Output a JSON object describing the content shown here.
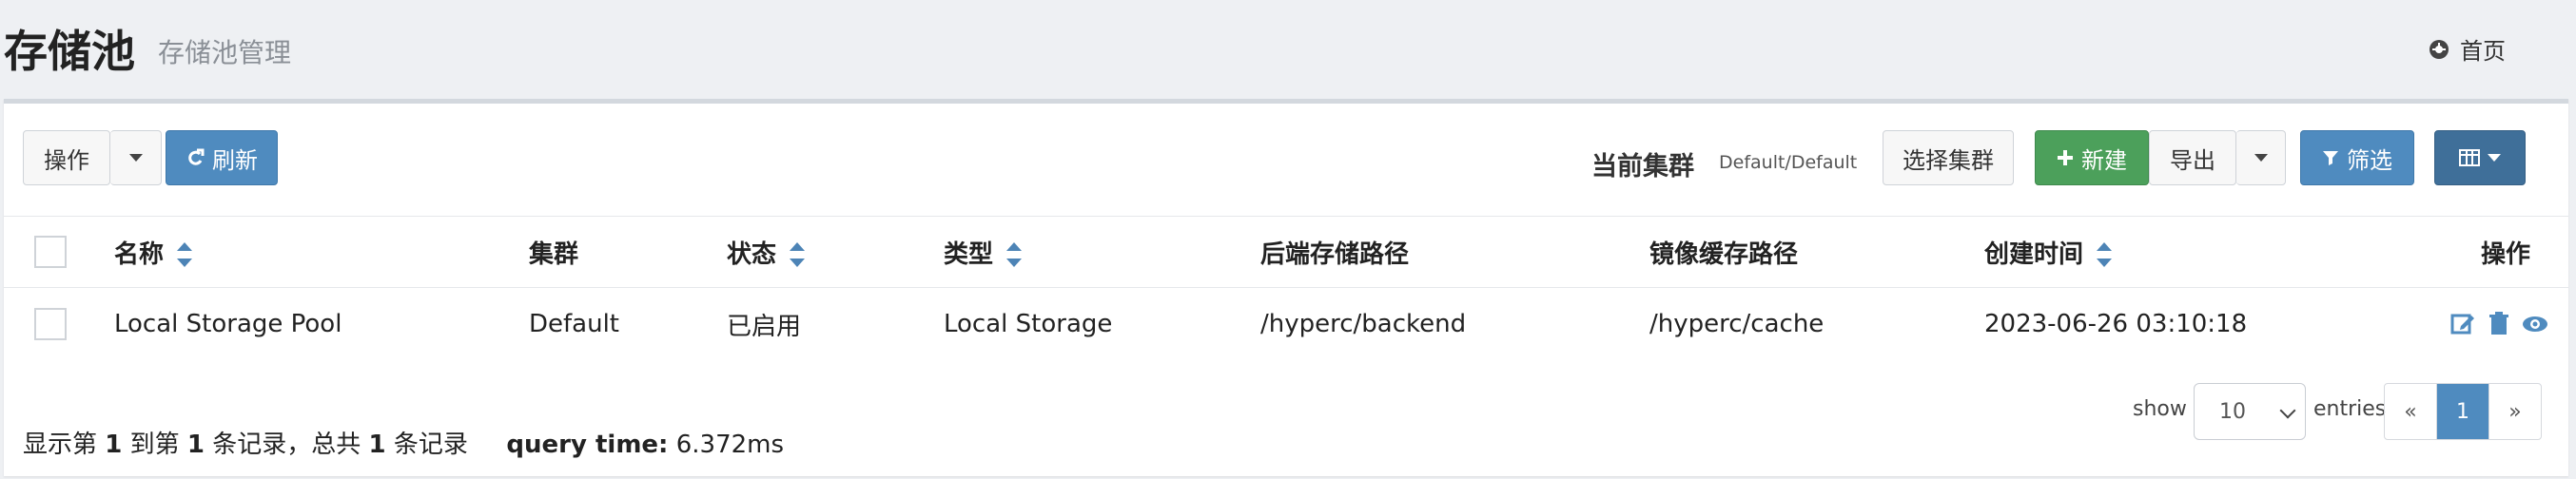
{
  "header": {
    "title": "存储池",
    "subtitle": "存储池管理",
    "home": "首页"
  },
  "toolbar": {
    "operate_label": "操作",
    "refresh_label": "刷新",
    "cluster_label": "当前集群",
    "cluster_value": "Default/Default",
    "choose_cluster_label": "选择集群",
    "new_label": "新建",
    "export_label": "导出",
    "filter_label": "筛选"
  },
  "table": {
    "headers": [
      "名称",
      "集群",
      "状态",
      "类型",
      "后端存储路径",
      "镜像缓存路径",
      "创建时间",
      "操作"
    ],
    "rows": [
      {
        "name": "Local Storage Pool",
        "cluster": "Default",
        "status": "已启用",
        "type": "Local Storage",
        "backend_path": "/hyperc/backend",
        "cache_path": "/hyperc/cache",
        "created_at": "2023-06-26 03:10:18"
      }
    ]
  },
  "footer": {
    "summary_prefix": "显示第 ",
    "summary_start": "1",
    "summary_mid1": " 到第 ",
    "summary_end": "1",
    "summary_mid2": " 条记录，总共 ",
    "summary_total": "1",
    "summary_suffix": " 条记录",
    "query_label": "query time:",
    "query_value": "6.372ms",
    "show_label": "show",
    "page_size": "10",
    "entries_label": "entries",
    "pagination": [
      "«",
      "1",
      "»"
    ]
  },
  "colors": {
    "primary": "#4f8bbf",
    "success": "#4ca05b",
    "dark_primary": "#3f6f99"
  },
  "icons": {
    "home": "dashboard-icon",
    "refresh": "refresh-icon",
    "plus": "plus-icon",
    "filter": "filter-icon",
    "columns": "table-icon",
    "edit": "edit-icon",
    "delete": "trash-icon",
    "view": "eye-icon"
  }
}
